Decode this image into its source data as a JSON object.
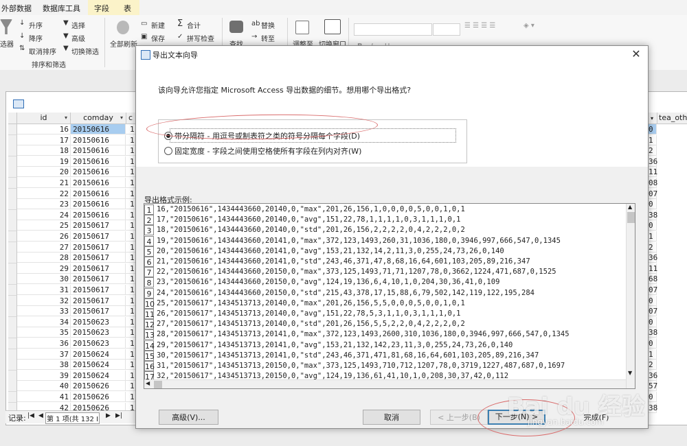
{
  "ribbon": {
    "tabs": [
      "外部数据",
      "数据库工具",
      "字段",
      "表"
    ],
    "sort_group": {
      "filter": "选器",
      "asc": "升序",
      "desc": "降序",
      "remove_sort": "取消排序",
      "select": "选择",
      "advanced": "高级",
      "toggle_filter": "切换筛选",
      "group_label": "排序和筛选"
    },
    "records_group": {
      "refresh_all": "全部刷新",
      "new": "新建",
      "save": "保存",
      "total": "合计",
      "spelling": "拼写检查"
    },
    "find_group": {
      "find": "查找",
      "replace": "替换",
      "goto": "转至"
    },
    "window_group": {
      "resize": "调整至",
      "switch_windows": "切换窗口"
    },
    "text_group": {
      "bold": "B",
      "italic": "I",
      "underline": "U"
    }
  },
  "datasheet": {
    "columns": [
      "id",
      "comday",
      "c"
    ],
    "right_column": "tea_oth",
    "rows": [
      {
        "id": "16",
        "day": "20150616",
        "n": "1",
        "r": "0"
      },
      {
        "id": "17",
        "day": "20150616",
        "n": "1",
        "r": "1"
      },
      {
        "id": "18",
        "day": "20150616",
        "n": "1",
        "r": "2"
      },
      {
        "id": "19",
        "day": "20150616",
        "n": "1",
        "r": "36"
      },
      {
        "id": "20",
        "day": "20150616",
        "n": "1",
        "r": "11"
      },
      {
        "id": "21",
        "day": "20150616",
        "n": "1",
        "r": "08"
      },
      {
        "id": "22",
        "day": "20150616",
        "n": "1",
        "r": "07"
      },
      {
        "id": "23",
        "day": "20150616",
        "n": "1",
        "r": "0"
      },
      {
        "id": "24",
        "day": "20150616",
        "n": "1",
        "r": "38"
      },
      {
        "id": "25",
        "day": "20150617",
        "n": "1",
        "r": "0"
      },
      {
        "id": "26",
        "day": "20150617",
        "n": "1",
        "r": "1"
      },
      {
        "id": "27",
        "day": "20150617",
        "n": "1",
        "r": "2"
      },
      {
        "id": "28",
        "day": "20150617",
        "n": "1",
        "r": "36"
      },
      {
        "id": "29",
        "day": "20150617",
        "n": "1",
        "r": "11"
      },
      {
        "id": "30",
        "day": "20150617",
        "n": "1",
        "r": "68"
      },
      {
        "id": "31",
        "day": "20150617",
        "n": "1",
        "r": "07"
      },
      {
        "id": "32",
        "day": "20150617",
        "n": "1",
        "r": "0"
      },
      {
        "id": "33",
        "day": "20150617",
        "n": "1",
        "r": "07"
      },
      {
        "id": "34",
        "day": "20150623",
        "n": "1",
        "r": "0"
      },
      {
        "id": "35",
        "day": "20150623",
        "n": "1",
        "r": "38"
      },
      {
        "id": "36",
        "day": "20150623",
        "n": "1",
        "r": "0"
      },
      {
        "id": "37",
        "day": "20150624",
        "n": "1",
        "r": "1"
      },
      {
        "id": "38",
        "day": "20150624",
        "n": "1",
        "r": "2"
      },
      {
        "id": "39",
        "day": "20150624",
        "n": "1",
        "r": "36"
      },
      {
        "id": "40",
        "day": "20150626",
        "n": "1",
        "r": "57"
      },
      {
        "id": "41",
        "day": "20150626",
        "n": "1",
        "r": "0"
      },
      {
        "id": "42",
        "day": "20150626",
        "n": "1",
        "r": "38"
      }
    ],
    "status": {
      "label": "记录:",
      "nav_first": "|◀",
      "nav_prev": "◀",
      "position": "第 1 项(共 132 I",
      "nav_next": "▶",
      "nav_last": "▶|"
    }
  },
  "dialog": {
    "title": "导出文本向导",
    "close": "✕",
    "intro": "该向导允许您指定 Microsoft Access 导出数据的细节。想用哪个导出格式?",
    "options": [
      {
        "label": "带分隔符 - 用逗号或制表符之类的符号分隔每个字段(D)",
        "selected": true
      },
      {
        "label": "固定宽度 - 字段之间使用空格使所有字段在列内对齐(W)",
        "selected": false
      }
    ],
    "sample_label": "导出格式示例:",
    "sample_lines": [
      "16,\"20150616\",1434443660,20140,0,\"max\",201,26,156,1,0,0,0,0,5,0,0,1,0,1",
      "17,\"20150616\",1434443660,20140,0,\"avg\",151,22,78,1,1,1,1,0,3,1,1,1,0,1",
      "18,\"20150616\",1434443660,20140,0,\"std\",201,26,156,2,2,2,2,0,4,2,2,2,0,2",
      "19,\"20150616\",1434443660,20141,0,\"max\",372,123,1493,260,31,1036,180,0,3946,997,666,547,0,1345",
      "20,\"20150616\",1434443660,20141,0,\"avg\",153,21,132,14,2,11,3,0,255,24,73,26,0,140",
      "21,\"20150616\",1434443660,20141,0,\"std\",243,46,371,47,8,68,16,64,601,103,205,89,216,347",
      "22,\"20150616\",1434443660,20150,0,\"max\",373,125,1493,71,71,1207,78,0,3662,1224,471,687,0,1525",
      "23,\"20150616\",1434443660,20150,0,\"avg\",124,19,136,6,4,10,1,0,204,30,36,41,0,109",
      "24,\"20150616\",1434443660,20150,0,\"std\",215,43,378,17,15,88,6,79,502,142,119,122,195,284",
      "25,\"20150617\",1434513713,20140,0,\"max\",201,26,156,5,5,0,0,0,5,0,0,1,0,1",
      "26,\"20150617\",1434513713,20140,0,\"avg\",151,22,78,5,3,1,1,0,3,1,1,1,0,1",
      "27,\"20150617\",1434513713,20140,0,\"std\",201,26,156,5,5,2,2,0,4,2,2,2,0,2",
      "28,\"20150617\",1434513713,20141,0,\"max\",372,123,1493,2600,310,1036,180,0,3946,997,666,547,0,1345",
      "29,\"20150617\",1434513713,20141,0,\"avg\",153,21,132,142,23,11,3,0,255,24,73,26,0,140",
      "30,\"20150617\",1434513713,20141,0,\"std\",243,46,371,471,81,68,16,64,601,103,205,89,216,347",
      "31,\"20150617\",1434513713,20150,0,\"max\",373,125,1493,710,712,1207,78,0,3719,1227,487,687,0,1697",
      "32,\"20150617\",1434513713,20150,0,\"avg\",124,19,136,61,41,10,1,0,208,30,37,42,0,112"
    ],
    "buttons": {
      "advanced": "高级(V)...",
      "cancel": "取消",
      "back": "< 上一步(B)",
      "next": "下一步(N) >",
      "finish": "完成(F)"
    }
  },
  "watermark": {
    "text": "Bai du 经验",
    "sub": "jingyan.baidu.com"
  },
  "colors": {
    "annotation": "#d96a6a",
    "selection": "#a8cdf0",
    "ribbon_active_tab": "#fbf3c9"
  }
}
